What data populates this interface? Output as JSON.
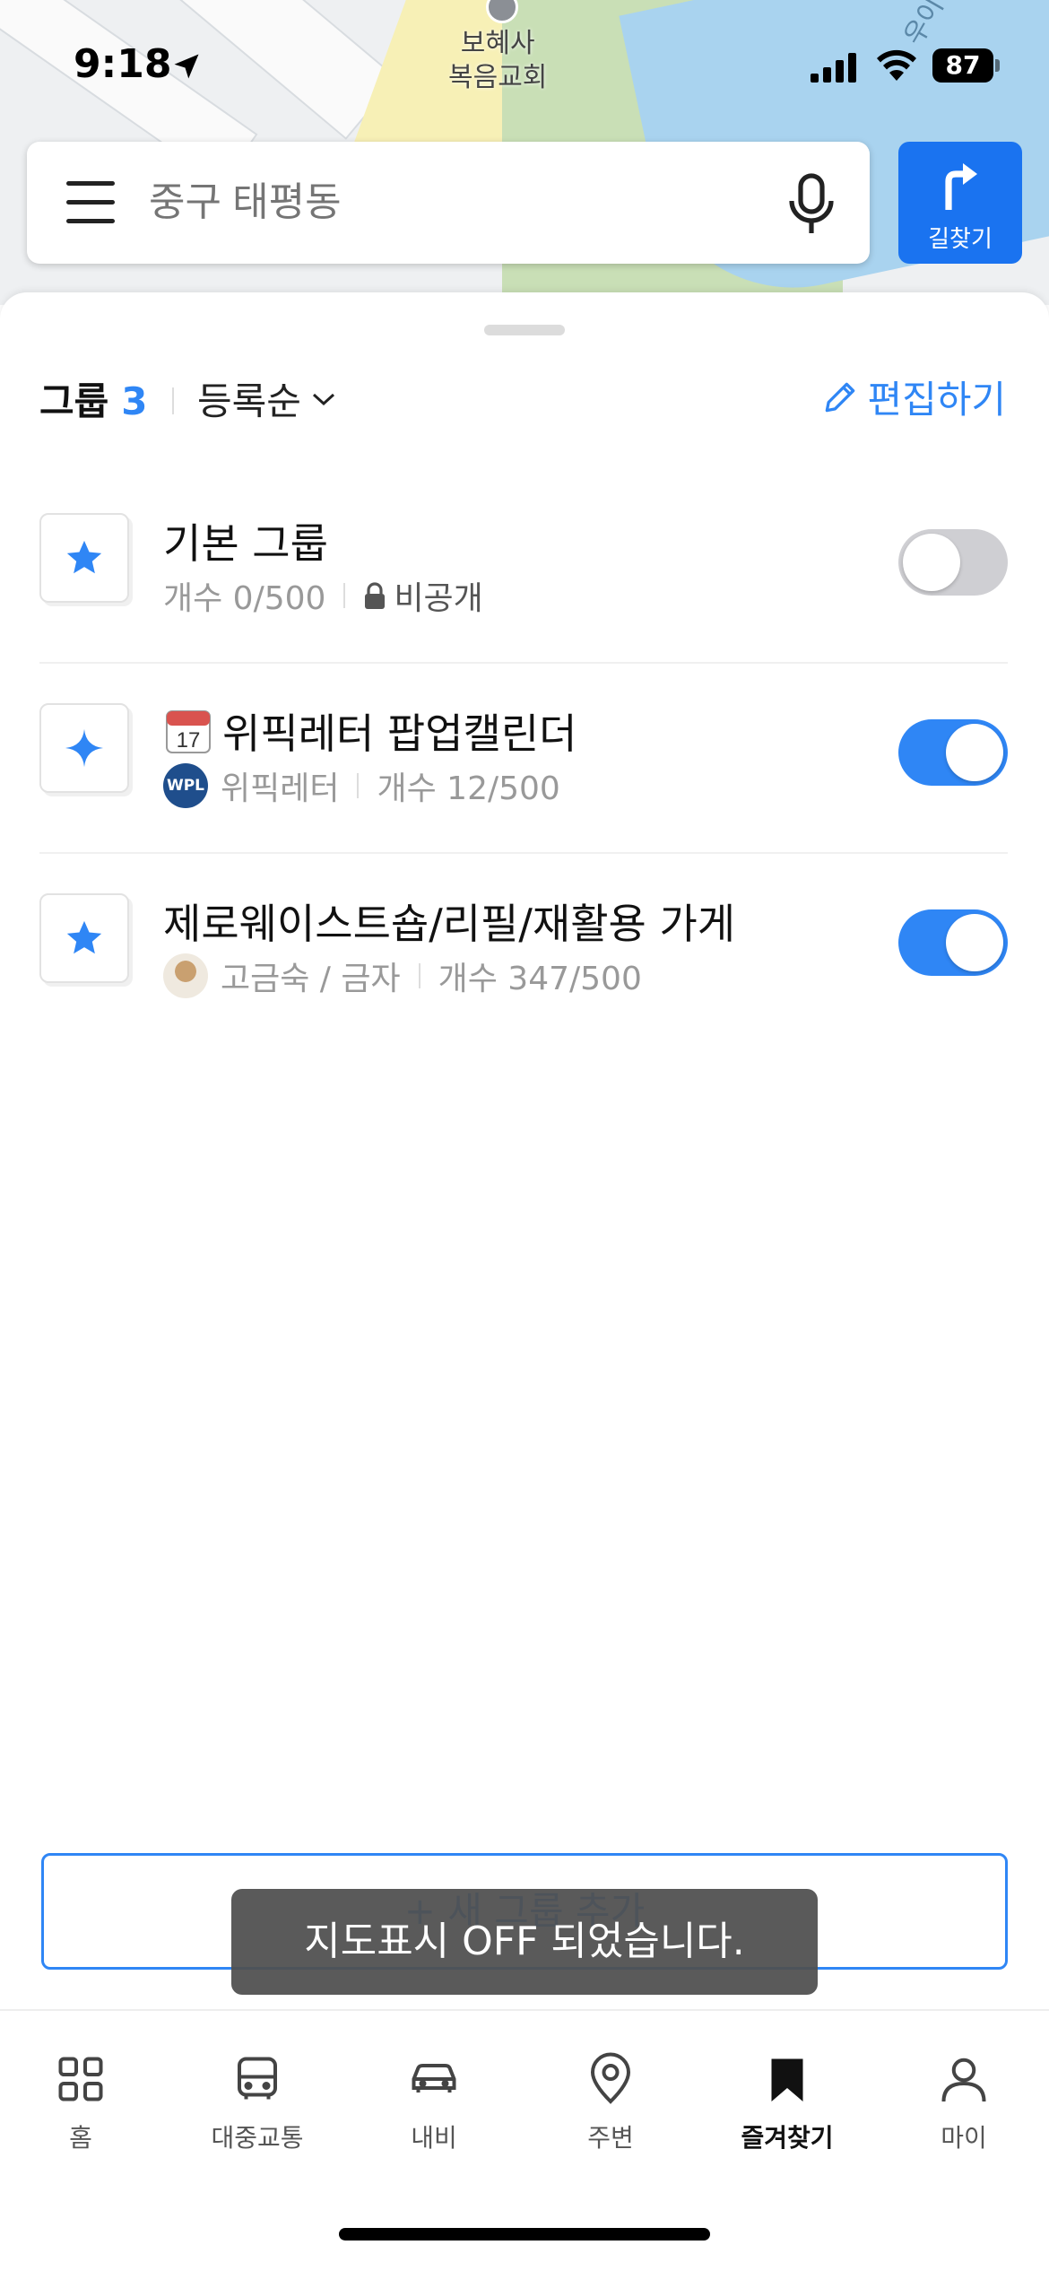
{
  "status_bar": {
    "time": "9:18",
    "battery": "87"
  },
  "map": {
    "poi_line1": "보혜사",
    "poi_line2": "복음교회",
    "river_label": "우이"
  },
  "search": {
    "placeholder": "중구 태평동"
  },
  "route_button": {
    "label": "길찾기"
  },
  "header": {
    "group_label": "그룹",
    "group_count": "3",
    "sort_label": "등록순",
    "edit_label": "편집하기"
  },
  "groups": [
    {
      "title": "기본 그룹",
      "count": "개수 0/500",
      "privacy": "비공개",
      "enabled": false
    },
    {
      "title": "위픽레터 팝업캘린더",
      "owner": "위픽레터",
      "owner_badge": "WPL",
      "count": "개수 12/500",
      "enabled": true
    },
    {
      "title": "제로웨이스트숍/리필/재활용 가게",
      "owner": "고금숙 / 금자",
      "count": "개수 347/500",
      "enabled": true
    }
  ],
  "add_group_label": "+ 새 그룹 추가",
  "toast": "지도표시 OFF 되었습니다.",
  "tabs": [
    {
      "label": "홈",
      "icon": "grid-icon"
    },
    {
      "label": "대중교통",
      "icon": "bus-icon"
    },
    {
      "label": "내비",
      "icon": "car-icon"
    },
    {
      "label": "주변",
      "icon": "pin-icon"
    },
    {
      "label": "즐겨찾기",
      "icon": "bookmark-icon",
      "active": true
    },
    {
      "label": "마이",
      "icon": "person-icon"
    }
  ],
  "colors": {
    "accent": "#2f86f5",
    "route_button": "#1a73f0"
  }
}
